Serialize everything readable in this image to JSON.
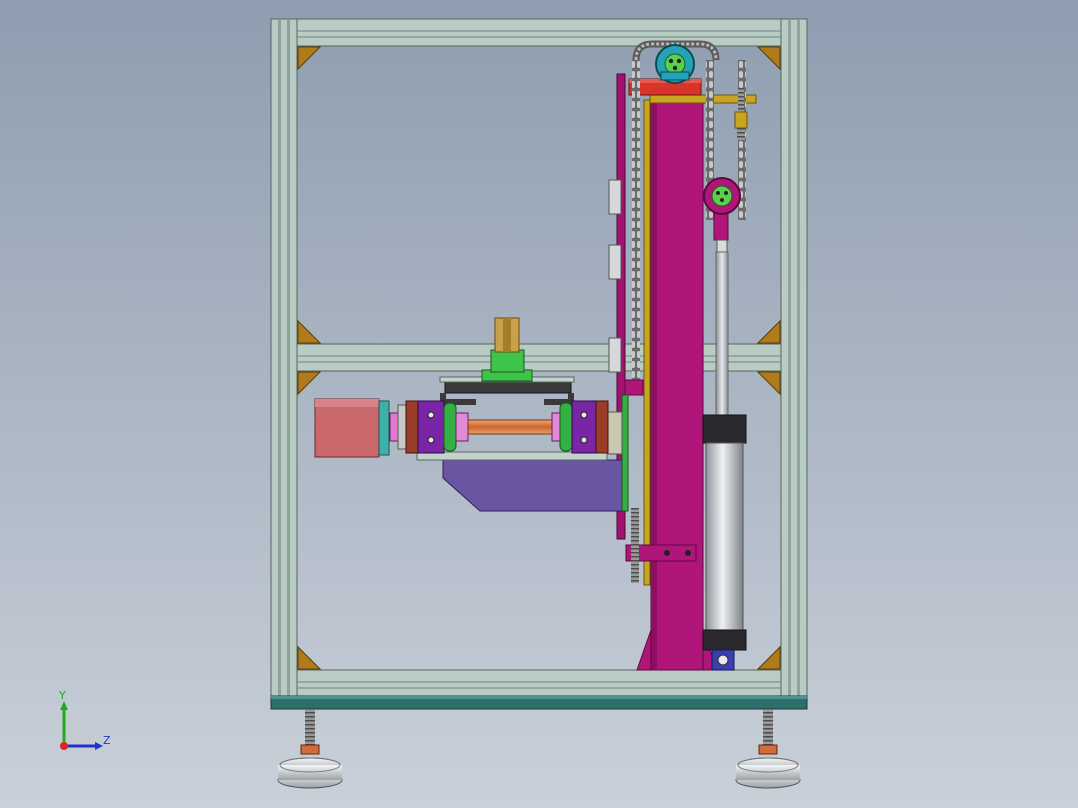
{
  "viewport": {
    "background_top": "#8e9db0",
    "background_bottom": "#c9d0d9"
  },
  "colors": {
    "frame_profile": "#b5c8c0",
    "frame_edge": "#5d6e6a",
    "base_plate": "#2e6e6c",
    "gusset": "#b07b1c",
    "column": "#b0157a",
    "column_dark": "#7e0c58",
    "motor": "#c9676b",
    "shaft": "#e0844a",
    "bearing_purple": "#7a24a6",
    "bearing_green": "#33b043",
    "bearing_brown": "#9a3d28",
    "carriage": "#6a55a3",
    "hopper": "#c9a14a",
    "hopper_base": "#3fc44a",
    "chain": "#555555",
    "sprocket": "#24a3b8",
    "sprocket_green": "#5bd04e",
    "cylinder_body": "#c0c4c8",
    "cylinder_cap": "#2a2a2e",
    "yellow_bar": "#c9a421",
    "red_block": "#d8342a",
    "foot_thread": "#8a8a8a",
    "foot_pad": "#dcdfe3",
    "axis_x": "#d22",
    "axis_y": "#2a2",
    "axis_z": "#23c"
  },
  "orientation_triad": {
    "y_label": "Y",
    "z_label": "Z"
  }
}
